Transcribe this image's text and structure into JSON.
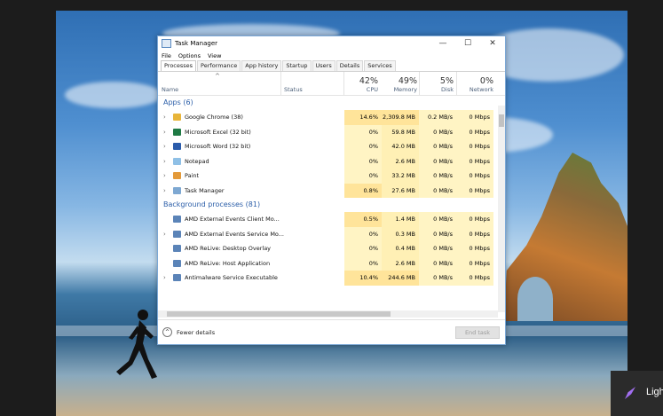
{
  "window": {
    "title": "Task Manager",
    "controls": {
      "minimize": "—",
      "maximize": "☐",
      "close": "✕"
    }
  },
  "menu": [
    "File",
    "Options",
    "View"
  ],
  "tabs": [
    "Processes",
    "Performance",
    "App history",
    "Startup",
    "Users",
    "Details",
    "Services"
  ],
  "columns": {
    "name": "Name",
    "status": "Status",
    "cpu": {
      "pct": "42%",
      "label": "CPU"
    },
    "memory": {
      "pct": "49%",
      "label": "Memory"
    },
    "disk": {
      "pct": "5%",
      "label": "Disk"
    },
    "network": {
      "pct": "0%",
      "label": "Network"
    }
  },
  "groups": {
    "apps": "Apps (6)",
    "background": "Background processes (81)"
  },
  "apps": [
    {
      "name": "Google Chrome (38)",
      "cpu": "14.6%",
      "memory": "2,309.8 MB",
      "disk": "0.2 MB/s",
      "network": "0 Mbps",
      "icon": "chrome-icon",
      "color": "#e8b53a",
      "expand": "›"
    },
    {
      "name": "Microsoft Excel (32 bit)",
      "cpu": "0%",
      "memory": "59.8 MB",
      "disk": "0 MB/s",
      "network": "0 Mbps",
      "icon": "excel-icon",
      "color": "#1f7a44",
      "expand": "›"
    },
    {
      "name": "Microsoft Word (32 bit)",
      "cpu": "0%",
      "memory": "42.0 MB",
      "disk": "0 MB/s",
      "network": "0 Mbps",
      "icon": "word-icon",
      "color": "#2b5cab",
      "expand": "›"
    },
    {
      "name": "Notepad",
      "cpu": "0%",
      "memory": "2.6 MB",
      "disk": "0 MB/s",
      "network": "0 Mbps",
      "icon": "notepad-icon",
      "color": "#8fc0e6",
      "expand": "›"
    },
    {
      "name": "Paint",
      "cpu": "0%",
      "memory": "33.2 MB",
      "disk": "0 MB/s",
      "network": "0 Mbps",
      "icon": "paint-icon",
      "color": "#e39a3a",
      "expand": "›"
    },
    {
      "name": "Task Manager",
      "cpu": "0.8%",
      "memory": "27.6 MB",
      "disk": "0 MB/s",
      "network": "0 Mbps",
      "icon": "task-manager-icon",
      "color": "#7ea8d2",
      "expand": "›"
    }
  ],
  "background": [
    {
      "name": "AMD External Events Client Mo...",
      "cpu": "0.5%",
      "memory": "1.4 MB",
      "disk": "0 MB/s",
      "network": "0 Mbps",
      "icon": "service-icon",
      "color": "#5b84b8",
      "expand": ""
    },
    {
      "name": "AMD External Events Service Mo...",
      "cpu": "0%",
      "memory": "0.3 MB",
      "disk": "0 MB/s",
      "network": "0 Mbps",
      "icon": "service-icon",
      "color": "#5b84b8",
      "expand": "›"
    },
    {
      "name": "AMD ReLive: Desktop Overlay",
      "cpu": "0%",
      "memory": "0.4 MB",
      "disk": "0 MB/s",
      "network": "0 Mbps",
      "icon": "service-icon",
      "color": "#5b84b8",
      "expand": ""
    },
    {
      "name": "AMD ReLive: Host Application",
      "cpu": "0%",
      "memory": "2.6 MB",
      "disk": "0 MB/s",
      "network": "0 Mbps",
      "icon": "service-icon",
      "color": "#5b84b8",
      "expand": ""
    },
    {
      "name": "Antimalware Service Executable",
      "cpu": "10.4%",
      "memory": "244.6 MB",
      "disk": "0 MB/s",
      "network": "0 Mbps",
      "icon": "shield-icon",
      "color": "#5b84b8",
      "expand": "›"
    }
  ],
  "footer": {
    "fewer_details": "Fewer details",
    "end_task": "End task"
  },
  "toast": {
    "text": "Ligh"
  },
  "colors": {
    "cpu_col": "#fff4c4",
    "mem_col": "#fff0b5",
    "hot_cell": "#ffe49a",
    "group_text": "#2b5ea8",
    "window_border": "#7aa7d6"
  }
}
